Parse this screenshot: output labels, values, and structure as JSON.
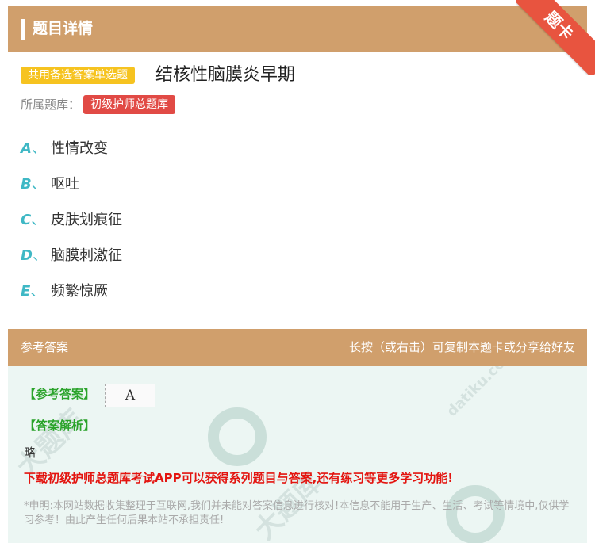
{
  "header": {
    "title": "题目详情",
    "ribbon": "题卡"
  },
  "question": {
    "type_badge": "共用备选答案单选题",
    "title": "结核性脑膜炎早期",
    "bank_label": "所属题库：",
    "bank_tag": "初级护师总题库",
    "options": [
      {
        "letter": "A",
        "sep": "、",
        "text": "性情改变"
      },
      {
        "letter": "B",
        "sep": "、",
        "text": "呕吐"
      },
      {
        "letter": "C",
        "sep": "、",
        "text": "皮肤划痕征"
      },
      {
        "letter": "D",
        "sep": "、",
        "text": "脑膜刺激征"
      },
      {
        "letter": "E",
        "sep": "、",
        "text": "频繁惊厥"
      }
    ]
  },
  "answer": {
    "bar_label": "参考答案",
    "bar_hint": "长按（或右击）可复制本题卡或分享给好友",
    "answer_label": "【参考答案】",
    "answer_value": "A",
    "explanation_label": "【答案解析】",
    "explanation_text": "略",
    "promo": "下载初级护师总题库考试APP可以获得系列题目与答案,还有练习等更多学习功能!",
    "disclaimer": "*申明:本网站数据收集整理于互联网,我们并未能对答案信息进行核对!本信息不能用于生产、生活、考试等情境中,仅供学习参考！由此产生任何后果本站不承担责任!"
  },
  "colors": {
    "header_bg": "#d09f6c",
    "ribbon": "#e8543f",
    "type_badge": "#f6c320",
    "bank_tag": "#e14a45",
    "option_letter": "#3fb8c5",
    "answer_label": "#2aa32a",
    "promo": "#e3140f",
    "panel_bg": "#ecf6f3"
  },
  "watermark": {
    "brand": "大题库",
    "domain": "datiku.com"
  }
}
